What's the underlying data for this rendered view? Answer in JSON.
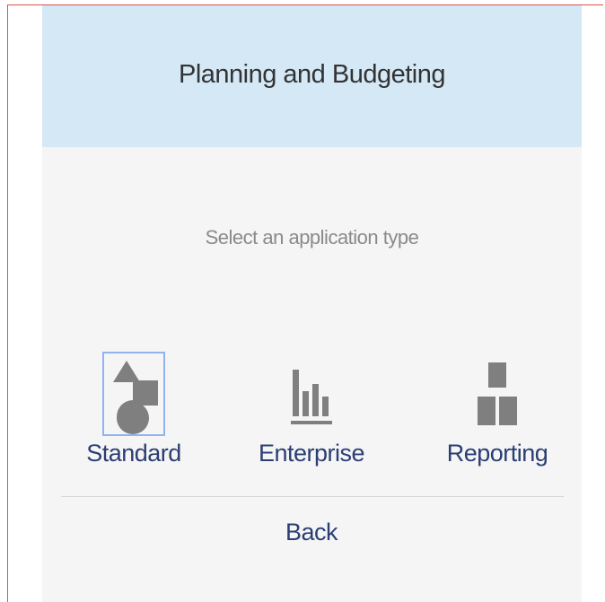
{
  "header": {
    "title": "Planning and Budgeting"
  },
  "prompt": {
    "text": "Select an application type"
  },
  "options": [
    {
      "label": "Standard",
      "icon": "shapes-icon",
      "selected": true
    },
    {
      "label": "Enterprise",
      "icon": "bar-chart-icon",
      "selected": false
    },
    {
      "label": "Reporting",
      "icon": "blocks-icon",
      "selected": false
    }
  ],
  "footer": {
    "back_label": "Back"
  },
  "colors": {
    "header_bg": "#d4e8f6",
    "panel_bg": "#f5f5f5",
    "icon_gray": "#7f7f7f",
    "link_text": "#2b3e74",
    "selection_outline": "#8fb4f0"
  }
}
